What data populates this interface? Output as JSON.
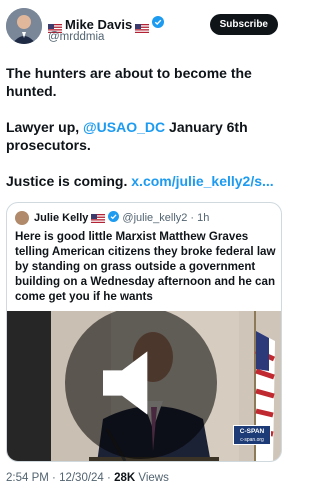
{
  "header": {
    "display_name": "Mike Davis",
    "handle": "@mrddmia",
    "subscribe_label": "Subscribe"
  },
  "post": {
    "para1": "The hunters are about to become the hunted.",
    "para2_prefix": "Lawyer up, ",
    "para2_mention": "@USAO_DC",
    "para2_suffix": " January 6th prosecutors.",
    "para3_prefix": "Justice is coming. ",
    "para3_link": "x.com/julie_kelly2/s..."
  },
  "quote": {
    "display_name": "Julie Kelly",
    "handle": "@julie_kelly2",
    "time": "· 1h",
    "text": "Here is good little Marxist Matthew Graves telling American citizens they broke federal law by standing on grass outside a government building on a Wednesday afternoon and he can come get you if he wants",
    "media_badge_line1": "C-SPAN",
    "media_badge_line2": "c-span.org"
  },
  "meta": {
    "time": "2:54 PM",
    "date": "12/30/24",
    "views_count": "28K",
    "views_label": "Views"
  },
  "icons": {
    "verified": "verified-badge-icon",
    "flag": "us-flag-icon",
    "volume": "volume-icon"
  },
  "colors": {
    "accent": "#1d9bf0",
    "text": "#0f1419",
    "muted": "#536471"
  }
}
